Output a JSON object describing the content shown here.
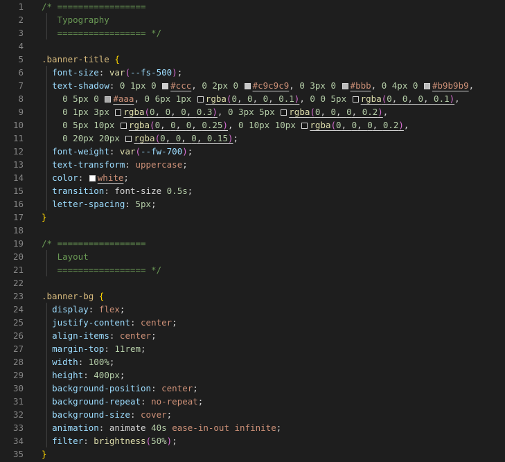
{
  "editor": {
    "language": "css",
    "colors": {
      "background": "#1e1e1e",
      "line_number": "#858585",
      "comment": "#6a9955",
      "selector": "#d7ba7d",
      "property": "#9cdcfe",
      "value": "#ce9178",
      "number": "#b5cea8",
      "brace": "#ffd700"
    },
    "lines": [
      {
        "n": "1",
        "text": "/* ================="
      },
      {
        "n": "2",
        "text": "   Typography"
      },
      {
        "n": "3",
        "text": "   ================= */"
      },
      {
        "n": "4",
        "text": ""
      },
      {
        "n": "5",
        "text": ".banner-title {"
      },
      {
        "n": "6",
        "text": "  font-size: var(--fs-500);"
      },
      {
        "n": "7",
        "text": "  text-shadow: 0 1px 0 #ccc, 0 2px 0 #c9c9c9, 0 3px 0 #bbb, 0 4px 0 #b9b9b9,"
      },
      {
        "n": "8",
        "text": "    0 5px 0 #aaa, 0 6px 1px rgba(0, 0, 0, 0.1), 0 0 5px rgba(0, 0, 0, 0.1),"
      },
      {
        "n": "9",
        "text": "    0 1px 3px rgba(0, 0, 0, 0.3), 0 3px 5px rgba(0, 0, 0, 0.2),"
      },
      {
        "n": "10",
        "text": "    0 5px 10px rgba(0, 0, 0, 0.25), 0 10px 10px rgba(0, 0, 0, 0.2),"
      },
      {
        "n": "11",
        "text": "    0 20px 20px rgba(0, 0, 0, 0.15);"
      },
      {
        "n": "12",
        "text": "  font-weight: var(--fw-700);"
      },
      {
        "n": "13",
        "text": "  text-transform: uppercase;"
      },
      {
        "n": "14",
        "text": "  color: white;"
      },
      {
        "n": "15",
        "text": "  transition: font-size 0.5s;"
      },
      {
        "n": "16",
        "text": "  letter-spacing: 5px;"
      },
      {
        "n": "17",
        "text": "}"
      },
      {
        "n": "18",
        "text": ""
      },
      {
        "n": "19",
        "text": "/* ================="
      },
      {
        "n": "20",
        "text": "   Layout"
      },
      {
        "n": "21",
        "text": "   ================= */"
      },
      {
        "n": "22",
        "text": ""
      },
      {
        "n": "23",
        "text": ".banner-bg {"
      },
      {
        "n": "24",
        "text": "  display: flex;"
      },
      {
        "n": "25",
        "text": "  justify-content: center;"
      },
      {
        "n": "26",
        "text": "  align-items: center;"
      },
      {
        "n": "27",
        "text": "  margin-top: 11rem;"
      },
      {
        "n": "28",
        "text": "  width: 100%;"
      },
      {
        "n": "29",
        "text": "  height: 400px;"
      },
      {
        "n": "30",
        "text": "  background-position: center;"
      },
      {
        "n": "31",
        "text": "  background-repeat: no-repeat;"
      },
      {
        "n": "32",
        "text": "  background-size: cover;"
      },
      {
        "n": "33",
        "text": "  animation: animate 40s ease-in-out infinite;"
      },
      {
        "n": "34",
        "text": "  filter: brightness(50%);"
      },
      {
        "n": "35",
        "text": "}"
      }
    ]
  }
}
